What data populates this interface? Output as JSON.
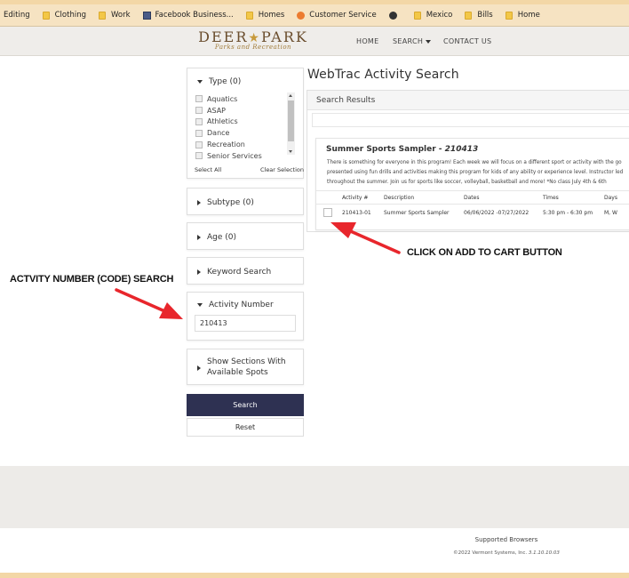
{
  "bookmarks": [
    {
      "label": "Editing",
      "icon": "none"
    },
    {
      "label": "Clothing",
      "icon": "folder-icon"
    },
    {
      "label": "Work",
      "icon": "folder-icon"
    },
    {
      "label": "Facebook Business...",
      "icon": "facebook-business-icon"
    },
    {
      "label": "Homes",
      "icon": "folder-icon"
    },
    {
      "label": "Customer Service",
      "icon": "customer-service-icon"
    },
    {
      "label": "",
      "icon": "globe-icon"
    },
    {
      "label": "Mexico",
      "icon": "folder-icon"
    },
    {
      "label": "Bills",
      "icon": "folder-icon"
    },
    {
      "label": "Home",
      "icon": "folder-icon"
    }
  ],
  "header": {
    "logo_main_left": "DEER",
    "logo_star": "★",
    "logo_main_right": "PARK",
    "logo_sub": "Parks and Recreation",
    "nav": {
      "home": "HOME",
      "search": "SEARCH",
      "contact": "CONTACT US"
    }
  },
  "sidebar": {
    "type": {
      "title": "Type",
      "count": "(0)",
      "items": [
        "Aquatics",
        "ASAP",
        "Athletics",
        "Dance",
        "Recreation",
        "Senior Services"
      ],
      "select_all": "Select All",
      "clear_selection": "Clear Selection"
    },
    "subtype": {
      "title": "Subtype",
      "count": "(0)"
    },
    "age": {
      "title": "Age",
      "count": "(0)"
    },
    "keyword": {
      "title": "Keyword Search"
    },
    "activity_number": {
      "title": "Activity Number",
      "value": "210413"
    },
    "sections": {
      "line1": "Show Sections With",
      "line2": "Available Spots"
    },
    "search_label": "Search",
    "reset_label": "Reset"
  },
  "main": {
    "title": "WebTrac Activity Search",
    "results_header": "Search Results",
    "card": {
      "title": "Summer Sports Sampler - ",
      "code": "210413",
      "desc_lines": [
        "There is something for everyone in this program! Each week we will focus on a different sport or activity with the go",
        "presented using fun drills and activities making this program for kids of any ability or experience level. Instructor led",
        "throughout the summer. Join us for sports like soccer, volleyball, basketball and more! *No class July 4th & 6th"
      ],
      "columns": [
        "Activity #",
        "Description",
        "Dates",
        "Times",
        "Days"
      ],
      "row": {
        "activity": "210413-01",
        "description": "Summer Sports Sampler",
        "dates": "06/06/2022 -07/27/2022",
        "times": "5:30 pm - 6:30 pm",
        "days": "M, W"
      }
    }
  },
  "annotations": {
    "left": "ACTVITY NUMBER (CODE) SEARCH",
    "right": "CLICK ON ADD TO CART BUTTON",
    "arrow_color": "#e8262c"
  },
  "footer": {
    "supported": "Supported Browsers",
    "copyright": "©2022 Vermont Systems, Inc. ",
    "version": "3.1.10.10.03"
  }
}
